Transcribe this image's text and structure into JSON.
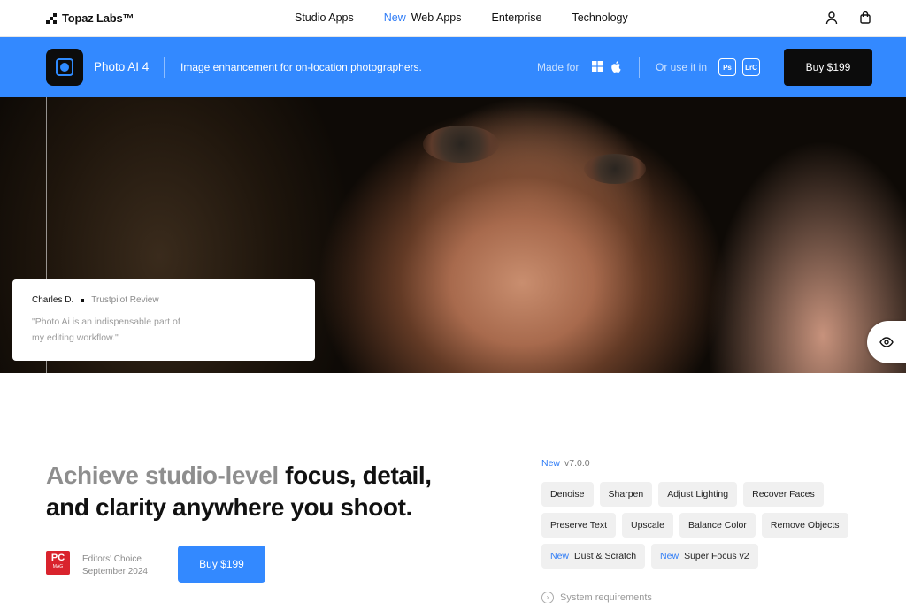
{
  "nav": {
    "logo": "Topaz Labs™",
    "links": [
      "Studio Apps",
      "Web Apps",
      "Enterprise",
      "Technology"
    ],
    "new_badge": "New",
    "icons": [
      "user-icon",
      "bag-icon"
    ]
  },
  "product_bar": {
    "name": "Photo AI 4",
    "tagline": "Image enhancement for on-location photographers.",
    "made_for": "Made for",
    "os_icons": [
      "windows-icon",
      "apple-icon"
    ],
    "use_in": "Or use it in",
    "plugins": [
      "Ps",
      "LrC"
    ],
    "buy_label": "Buy  $199"
  },
  "hero": {
    "review": {
      "author": "Charles D.",
      "source": "Trustpilot Review",
      "quote": "\"Photo Ai is an indispensable part of my editing workflow.\""
    }
  },
  "main": {
    "headline_muted": "Achieve studio-level",
    "headline_line1": " focus, detail,",
    "headline_line2": "and clarity anywhere you shoot.",
    "award_logo_top": "PC",
    "award_logo_bottom": "MAG",
    "award_title": "Editors' Choice",
    "award_date": "September 2024",
    "buy_label": "Buy  $199"
  },
  "features": {
    "new_label": "New",
    "version": "v7.0.0",
    "tags_row1": [
      "Denoise",
      "Sharpen",
      "Adjust Lighting",
      "Recover Faces"
    ],
    "tags_row2": [
      "Preserve Text",
      "Upscale",
      "Balance Color",
      "Remove Objects"
    ],
    "tags_row3": [
      "Dust & Scratch",
      "Super Focus v2"
    ],
    "system_requirements": "System requirements"
  },
  "colors": {
    "accent": "#3389ff",
    "dark": "#0c0c0c",
    "new_badge": "#2f7cf6"
  }
}
